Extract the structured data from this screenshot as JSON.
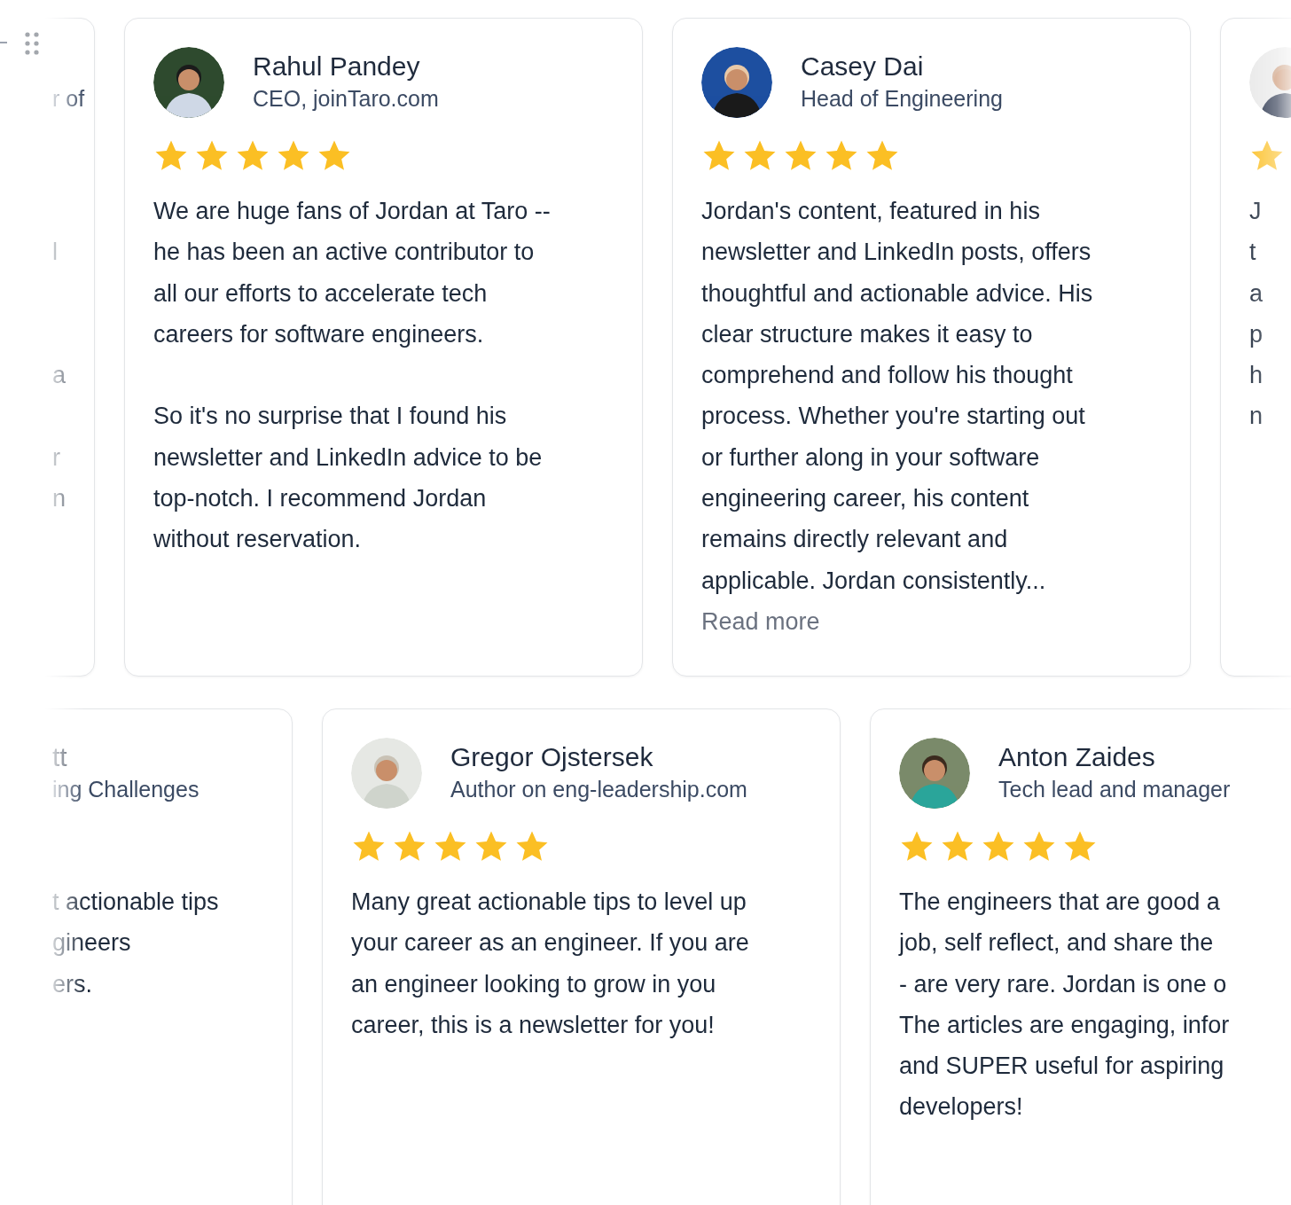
{
  "rows": [
    {
      "cards": [
        {
          "kind": "clipped-left",
          "subtitle": "r of",
          "body": "\nl\n\n\na\n\nr\nn"
        },
        {
          "kind": "full",
          "name": "Rahul Pandey",
          "subtitle": "CEO, joinTaro.com",
          "stars": 5,
          "body": "We are huge fans of Jordan at Taro --\nhe has been an active contributor to\nall our efforts to accelerate tech\ncareers for software engineers.\n\nSo it's no surprise that I found his\nnewsletter and LinkedIn advice to be\ntop-notch. I recommend Jordan\nwithout reservation."
        },
        {
          "kind": "full",
          "name": "Casey Dai",
          "subtitle": "Head of Engineering",
          "stars": 5,
          "body": "Jordan's content, featured in his\nnewsletter and LinkedIn posts, offers\nthoughtful and actionable advice. His\nclear structure makes it easy to\ncomprehend and follow his thought\nprocess. Whether you're starting out\nor further along in your software\nengineering career, his content\nremains directly relevant and\napplicable. Jordan consistently...",
          "read_more": "Read more"
        },
        {
          "kind": "clipped-right",
          "body": "J\nt\na\np\nh\nn"
        }
      ]
    },
    {
      "cards": [
        {
          "kind": "clipped-left",
          "name": "tt",
          "subtitle": "ing Challenges",
          "body": "t actionable tips\ngineers\ners."
        },
        {
          "kind": "full",
          "name": "Gregor Ojstersek",
          "subtitle": "Author on eng-leadership.com",
          "stars": 5,
          "body": "Many great actionable tips to level up\nyour career as an engineer. If you are\nan engineer looking to grow in you\ncareer, this is a newsletter for you!"
        },
        {
          "kind": "full",
          "name": "Anton Zaides",
          "subtitle": "Tech lead and manager",
          "stars": 5,
          "body": "The engineers that are good a\njob, self reflect, and share the\n- are very rare. Jordan is one o\nThe articles are engaging, infor\nand SUPER useful for aspiring\ndevelopers!"
        }
      ]
    }
  ]
}
